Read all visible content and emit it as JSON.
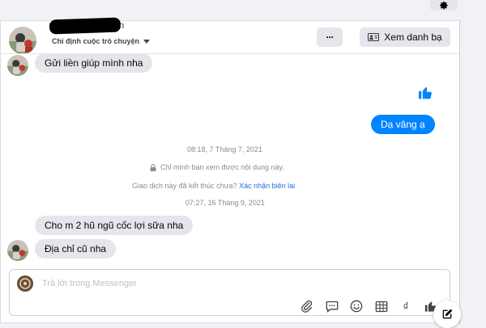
{
  "header": {
    "name_suffix": "n",
    "conversation_setting": "Chỉ định cuộc trò chuyện",
    "more_label": "···",
    "view_contacts_label": "Xem danh bạ"
  },
  "messages": {
    "incoming_1": "Gửi liền giúp mình nha",
    "outgoing_1": "Dạ vâng ạ",
    "timestamp_1": "08:18, 7 Tháng 7, 2021",
    "privacy_note": "Chỉ mình bạn xem được nội dung này.",
    "transaction_question": "Giao dịch này đã kết thúc chưa?",
    "confirm_receipt": "Xác nhận biên lai",
    "timestamp_2": "07:27, 16 Tháng 9, 2021",
    "incoming_2": "Cho m 2 hũ ngũ cốc lợi sữa nha",
    "incoming_3": "Địa chỉ cũ nha"
  },
  "composer": {
    "placeholder": "Trả lời trong Messenger",
    "currency_symbol": "₫"
  },
  "icons": {
    "settings": "gear-icon",
    "like": "thumbs-up-icon",
    "attach": "paperclip-icon",
    "saved_reply": "chat-bubble-icon",
    "emoji": "smiley-icon",
    "template": "table-icon",
    "currency": "dong-icon",
    "compose": "compose-icon",
    "lock": "lock-icon",
    "contacts": "contact-card-icon"
  },
  "colors": {
    "accent": "#0084ff",
    "incoming_bubble": "#e4e6eb",
    "link": "#216fdb"
  }
}
